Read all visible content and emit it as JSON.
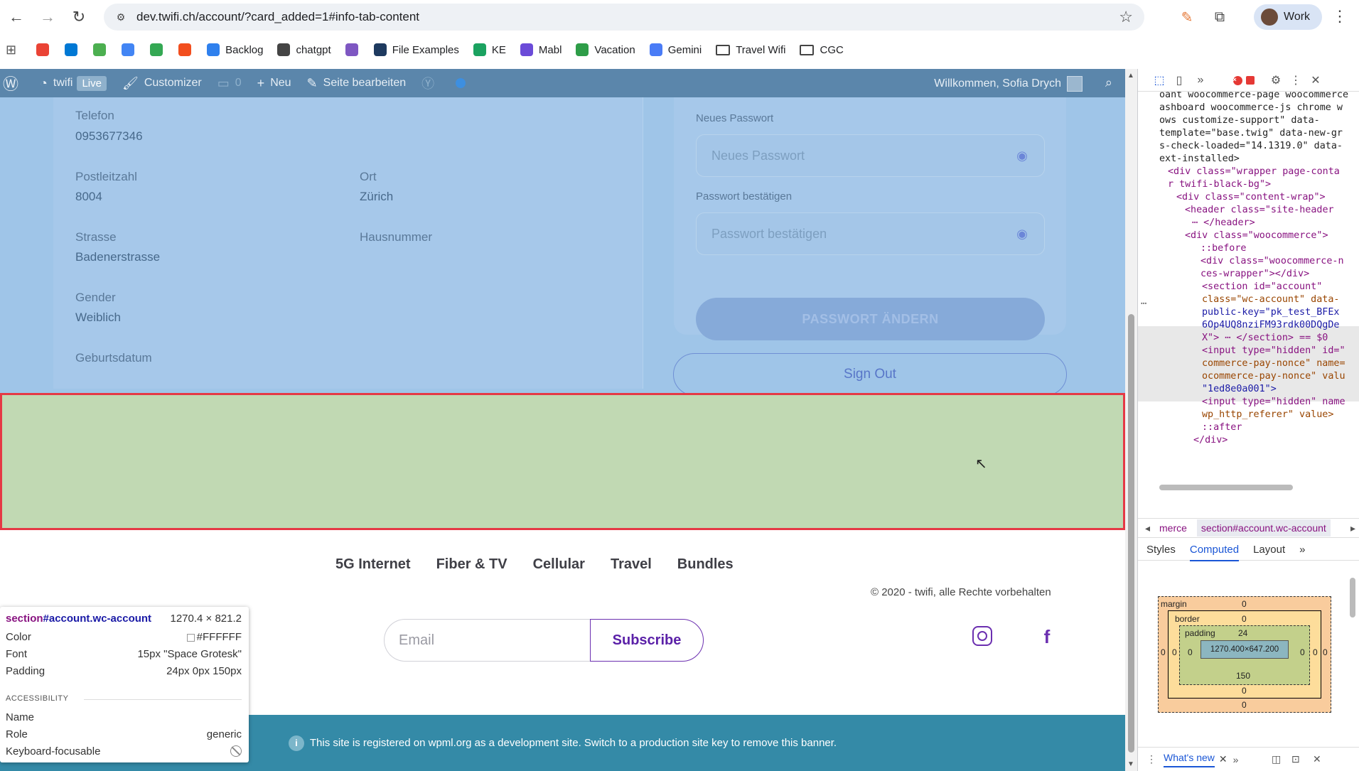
{
  "browser": {
    "url": "dev.twifi.ch/account/?card_added=1#info-tab-content",
    "profile_label": "Work",
    "bookmarks": [
      {
        "label": "",
        "icon": "gmail-icon",
        "color": "#ea4335"
      },
      {
        "label": "",
        "icon": "outlook-icon",
        "color": "#0078d4"
      },
      {
        "label": "",
        "icon": "extension-green-icon",
        "color": "#4caf50"
      },
      {
        "label": "",
        "icon": "translate-icon",
        "color": "#4285f4"
      },
      {
        "label": "",
        "icon": "drive-icon",
        "color": "#34a853"
      },
      {
        "label": "",
        "icon": "figma-icon",
        "color": "#f24e1e"
      },
      {
        "label": "Backlog",
        "icon": "backlog-icon",
        "color": "#2f80ed"
      },
      {
        "label": "chatgpt",
        "icon": "openai-icon",
        "color": "#444444"
      },
      {
        "label": "",
        "icon": "planet-icon",
        "color": "#7e57c2"
      },
      {
        "label": "File Examples",
        "icon": "fex-icon",
        "color": "#1e3a5f"
      },
      {
        "label": "KE",
        "icon": "ke-icon",
        "color": "#1ba260"
      },
      {
        "label": "Mabl",
        "icon": "mabl-icon",
        "color": "#6b4bd8"
      },
      {
        "label": "Vacation",
        "icon": "plus-square-icon",
        "color": "#2e9d48"
      },
      {
        "label": "Gemini",
        "icon": "gemini-icon",
        "color": "#4a7cf6"
      },
      {
        "label": "Travel Wifi",
        "icon": "folder-icon",
        "color": ""
      },
      {
        "label": "CGC",
        "icon": "folder-icon",
        "color": ""
      }
    ]
  },
  "wpbar": {
    "site": "twifi",
    "live": "Live",
    "customizer": "Customizer",
    "comments": "0",
    "new": "Neu",
    "edit": "Seite bearbeiten",
    "greeting": "Willkommen, Sofia Drych"
  },
  "profile": {
    "telefon_label": "Telefon",
    "telefon_value": "0953677346",
    "plz_label": "Postleitzahl",
    "plz_value": "8004",
    "ort_label": "Ort",
    "ort_value": "Zürich",
    "strasse_label": "Strasse",
    "strasse_value": "Badenerstrasse",
    "hausnummer_label": "Hausnummer",
    "gender_label": "Gender",
    "gender_value": "Weiblich",
    "geburtsdatum_label": "Geburtsdatum"
  },
  "password": {
    "new_label": "Neues Passwort",
    "new_placeholder": "Neues Passwort",
    "confirm_label": "Passwort bestätigen",
    "confirm_placeholder": "Passwort bestätigen",
    "change_button": "PASSWORT ÄNDERN",
    "signout_button": "Sign Out"
  },
  "footer": {
    "nav": [
      "5G Internet",
      "Fiber & TV",
      "Cellular",
      "Travel",
      "Bundles"
    ],
    "copyright": "© 2020 - twifi, alle Rechte vorbehalten",
    "email_placeholder": "Email",
    "subscribe": "Subscribe"
  },
  "banner": {
    "text": "This site is registered on wpml.org as a development site. Switch to a production site key to remove this banner."
  },
  "tooltip": {
    "selector": "section",
    "selector_id": "#account.wc-account",
    "size": "1270.4 × 821.2",
    "color_label": "Color",
    "color_value": "#FFFFFF",
    "font_label": "Font",
    "font_value": "15px \"Space Grotesk\"",
    "padding_label": "Padding",
    "padding_value": "24px 0px 150px",
    "accessibility": "ACCESSIBILITY",
    "name_label": "Name",
    "role_label": "Role",
    "role_value": "generic",
    "focus_label": "Keyboard-focusable"
  },
  "devtools": {
    "dom_lines": [
      "oant woocommerce-page woocommerce",
      "ashboard woocommerce-js chrome w",
      "ows customize-support\" data-",
      "template=\"base.twig\" data-new-gr",
      "s-check-loaded=\"14.1319.0\" data-",
      "ext-installed>",
      "<div class=\"wrapper page-conta",
      "r twifi-black-bg\">",
      "<div class=\"content-wrap\">",
      "<header class=\"site-header",
      "⋯ </header>",
      "<div class=\"woocommerce\">",
      "::before",
      "<div class=\"woocommerce-n",
      "ces-wrapper\"></div>",
      "<section id=\"account\"",
      "class=\"wc-account\" data-",
      "public-key=\"pk_test_BFEx",
      "6Op4UQ8nziFM93rdk00DQgDe",
      "X\"> ⋯ </section> == $0",
      "<input type=\"hidden\" id=\"",
      "commerce-pay-nonce\" name=",
      "ocommerce-pay-nonce\" valu",
      "\"1ed8e0a001\">",
      "<input type=\"hidden\" name",
      "wp_http_referer\" value>",
      "::after",
      "</div>"
    ],
    "crumb_1": "merce",
    "crumb_2": "section#account.wc-account",
    "tab_styles": "Styles",
    "tab_computed": "Computed",
    "tab_layout": "Layout",
    "box": {
      "margin_label": "margin",
      "border_label": "border",
      "padding_label": "padding",
      "margin_top": "0",
      "margin_right": "0",
      "margin_bottom": "0",
      "margin_left": "0",
      "border_top": "0",
      "border_right": "0",
      "border_bottom": "0",
      "border_left": "0",
      "padding_top": "24",
      "padding_right": "0",
      "padding_bottom": "150",
      "padding_left": "0",
      "content": "1270.400×647.200"
    },
    "drawer_tab": "What's new"
  },
  "colors": {
    "highlight_overlay": "#c1d9b3",
    "highlight_border": "#e53945",
    "wpbar": "#5b86ab",
    "banner": "#348aa7",
    "brand_purple": "#5b21a8"
  }
}
